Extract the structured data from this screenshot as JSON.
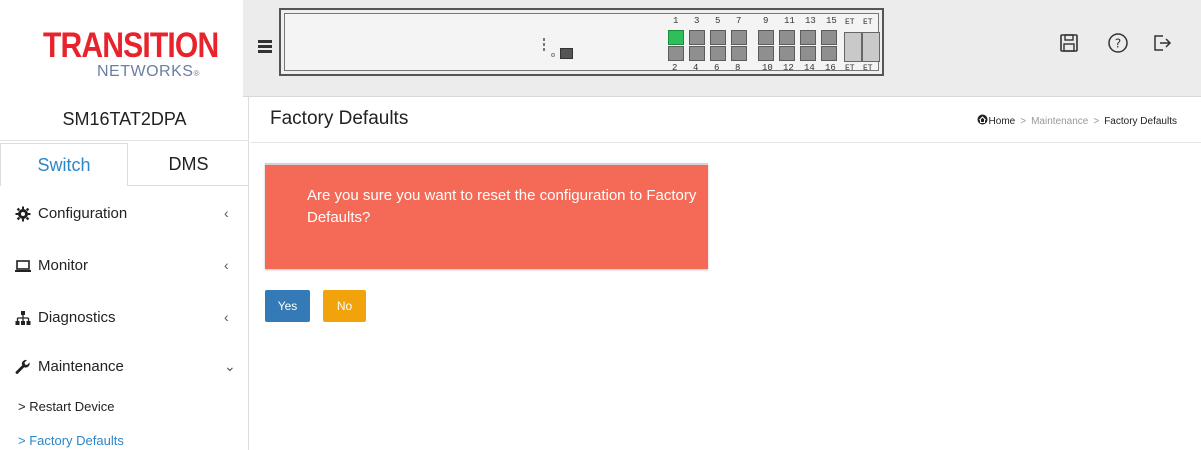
{
  "brand": {
    "logo_line1": "TRANSITION",
    "logo_line2": "NETWORKS",
    "logo_reg": "®"
  },
  "switch_panel": {
    "top_port_labels": [
      "1",
      "3",
      "5",
      "7",
      "9",
      "11",
      "13",
      "15"
    ],
    "bottom_port_labels": [
      "2",
      "4",
      "6",
      "8",
      "10",
      "12",
      "14",
      "16"
    ],
    "active_port": "1",
    "sfp_label": "ET"
  },
  "header_icons": [
    "save-icon",
    "help-icon",
    "logout-icon"
  ],
  "sidebar": {
    "device_name": "SM16TAT2DPA",
    "tabs": [
      {
        "label": "Switch",
        "active": true
      },
      {
        "label": "DMS",
        "active": false
      }
    ],
    "nav": [
      {
        "label": "Configuration",
        "icon": "gear-icon",
        "chevron": "‹"
      },
      {
        "label": "Monitor",
        "icon": "monitor-icon",
        "chevron": "‹"
      },
      {
        "label": "Diagnostics",
        "icon": "sitemap-icon",
        "chevron": "‹"
      },
      {
        "label": "Maintenance",
        "icon": "wrench-icon",
        "chevron": "⌄"
      }
    ],
    "sub_items": [
      {
        "label": "> Restart Device",
        "active": false
      },
      {
        "label": "> Factory Defaults",
        "active": true
      }
    ]
  },
  "page": {
    "title": "Factory Defaults",
    "breadcrumb": {
      "home": "Home",
      "section": "Maintenance",
      "current": "Factory Defaults",
      "separator": ">"
    }
  },
  "alert": {
    "message": "Are you sure you want to reset the configuration to Factory Defaults?"
  },
  "buttons": {
    "yes": "Yes",
    "no": "No"
  },
  "colors": {
    "accent": "#2d86c9",
    "alert_bg": "#f46a56",
    "yes_bg": "#337ab7",
    "no_bg": "#f0a30a",
    "port_active": "#2fbf5a",
    "logo_red": "#e8232b"
  }
}
